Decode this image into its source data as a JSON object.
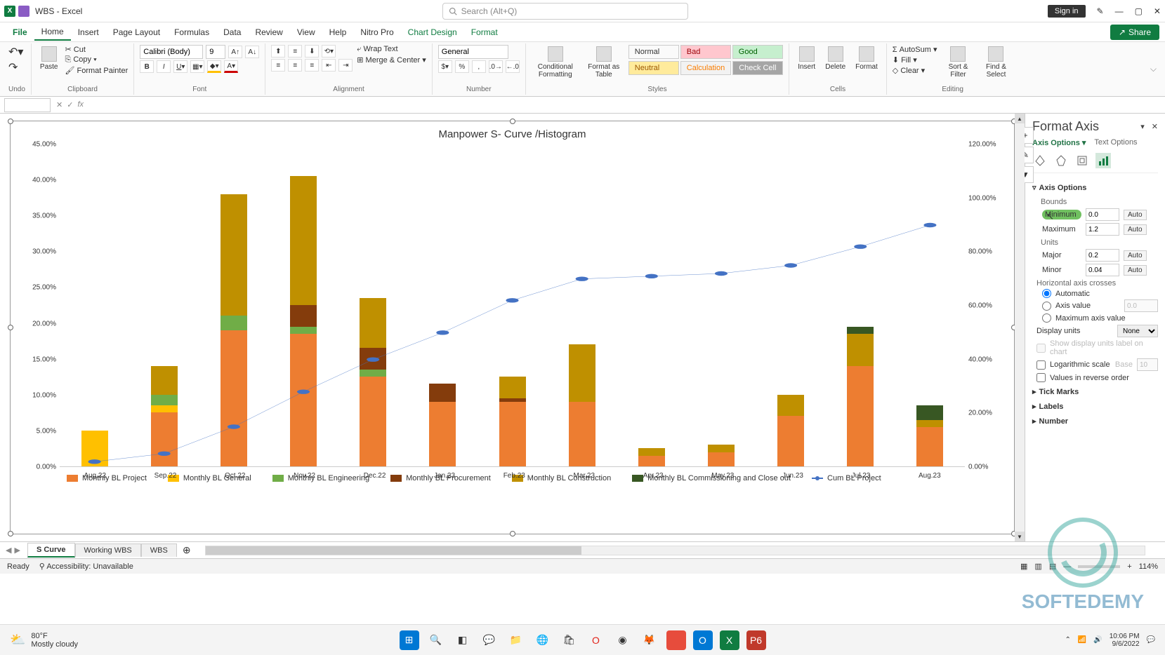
{
  "titlebar": {
    "title": "WBS - Excel",
    "search_placeholder": "Search (Alt+Q)",
    "signin": "Sign in"
  },
  "ribbon_tabs": {
    "file": "File",
    "home": "Home",
    "insert": "Insert",
    "page_layout": "Page Layout",
    "formulas": "Formulas",
    "data": "Data",
    "review": "Review",
    "view": "View",
    "help": "Help",
    "nitro": "Nitro Pro",
    "chart_design": "Chart Design",
    "format": "Format",
    "share": "Share"
  },
  "ribbon": {
    "undo": {
      "label": "Undo"
    },
    "clipboard": {
      "label": "Clipboard",
      "paste": "Paste",
      "cut": "Cut",
      "copy": "Copy",
      "painter": "Format Painter"
    },
    "font": {
      "label": "Font",
      "family": "Calibri (Body)",
      "size": "9"
    },
    "alignment": {
      "label": "Alignment",
      "wrap": "Wrap Text",
      "merge": "Merge & Center"
    },
    "number": {
      "label": "Number",
      "format": "General"
    },
    "styles": {
      "label": "Styles",
      "cond": "Conditional Formatting",
      "fmt_table": "Format as Table",
      "cells": [
        [
          "Normal",
          "Bad",
          "Good"
        ],
        [
          "Neutral",
          "Calculation",
          "Check Cell"
        ]
      ]
    },
    "cells": {
      "label": "Cells",
      "insert": "Insert",
      "delete": "Delete",
      "format": "Format"
    },
    "editing": {
      "label": "Editing",
      "autosum": "AutoSum",
      "fill": "Fill",
      "clear": "Clear",
      "sort": "Sort & Filter",
      "find": "Find & Select"
    }
  },
  "chart": {
    "title": "Manpower S- Curve /Histogram",
    "element_btns": {
      "plus": "+",
      "brush": "✎",
      "filter": "▼"
    }
  },
  "chart_data": {
    "type": "bar+line",
    "categories": [
      "Aug.22",
      "Sep.22",
      "Oct.22",
      "Nov.22",
      "Dec.22",
      "Jan.23",
      "Feb.23",
      "Mar.23",
      "Apr.23",
      "May.23",
      "Jun.23",
      "Jul.23",
      "Aug.23"
    ],
    "y_left": {
      "min": 0,
      "max": 45,
      "step": 5,
      "format": "0.00%",
      "ticks": [
        "0.00%",
        "5.00%",
        "10.00%",
        "15.00%",
        "20.00%",
        "25.00%",
        "30.00%",
        "35.00%",
        "40.00%",
        "45.00%"
      ]
    },
    "y_right": {
      "min": 0,
      "max": 120,
      "step": 20,
      "format": "0.00%",
      "ticks": [
        "0.00%",
        "20.00%",
        "40.00%",
        "60.00%",
        "80.00%",
        "100.00%",
        "120.00%"
      ]
    },
    "stacked_series": [
      {
        "name": "Monthly BL Project",
        "color": "#ed7d31",
        "values": [
          0,
          7.5,
          19,
          18.5,
          12.5,
          9,
          9,
          9,
          1.5,
          2,
          7,
          14,
          5.5
        ]
      },
      {
        "name": "Monthly BL General",
        "color": "#ffc000",
        "values": [
          5,
          1,
          0,
          0,
          0,
          0,
          0,
          0,
          0,
          0,
          0,
          0,
          0
        ]
      },
      {
        "name": "Monthly BL Engineering",
        "color": "#70ad47",
        "values": [
          0,
          1.5,
          2,
          1,
          1,
          0,
          0,
          0,
          0,
          0,
          0,
          0,
          0
        ]
      },
      {
        "name": "Monthly BL Procurement",
        "color": "#843c0c",
        "values": [
          0,
          0,
          0,
          3,
          3,
          2.5,
          0.5,
          0,
          0,
          0,
          0,
          0,
          0
        ]
      },
      {
        "name": "Monthly BL Construction",
        "color": "#bf9000",
        "values": [
          0,
          4,
          17,
          18,
          7,
          0,
          3,
          8,
          1,
          1,
          3,
          4.5,
          1
        ]
      },
      {
        "name": "Monthly BL Commissioning and Close out",
        "color": "#385723",
        "values": [
          0,
          0,
          0,
          0,
          0,
          0,
          0,
          0,
          0,
          0,
          0,
          1,
          2
        ]
      }
    ],
    "line_series": {
      "name": "Cum BL Project",
      "color": "#4472c4",
      "values": [
        2,
        5,
        15,
        28,
        40,
        50,
        62,
        70,
        71,
        72,
        75,
        82,
        90
      ]
    }
  },
  "format_pane": {
    "title": "Format Axis",
    "tab_options": "Axis Options",
    "tab_text": "Text Options",
    "section_axis_options": "Axis Options",
    "bounds": "Bounds",
    "min_label": "Minimum",
    "min_val": "0.0",
    "max_label": "Maximum",
    "max_val": "1.2",
    "units": "Units",
    "major_label": "Major",
    "major_val": "0.2",
    "minor_label": "Minor",
    "minor_val": "0.04",
    "auto": "Auto",
    "hcrosses": "Horizontal axis crosses",
    "automatic": "Automatic",
    "axis_value": "Axis value",
    "axis_value_val": "0.0",
    "max_axis": "Maximum axis value",
    "display_units": "Display units",
    "display_units_val": "None",
    "show_disp_label": "Show display units label on chart",
    "log_scale": "Logarithmic scale",
    "log_base": "Base",
    "log_base_val": "10",
    "reverse": "Values in reverse order",
    "tick_marks": "Tick Marks",
    "labels": "Labels",
    "number": "Number"
  },
  "sheets": {
    "s_curve": "S Curve",
    "working": "Working WBS",
    "wbs": "WBS"
  },
  "status": {
    "ready": "Ready",
    "access": "Accessibility: Unavailable",
    "zoom": "114%"
  },
  "taskbar": {
    "temp": "80°F",
    "cond": "Mostly cloudy",
    "time": "10:06 PM",
    "date": "9/6/2022"
  }
}
